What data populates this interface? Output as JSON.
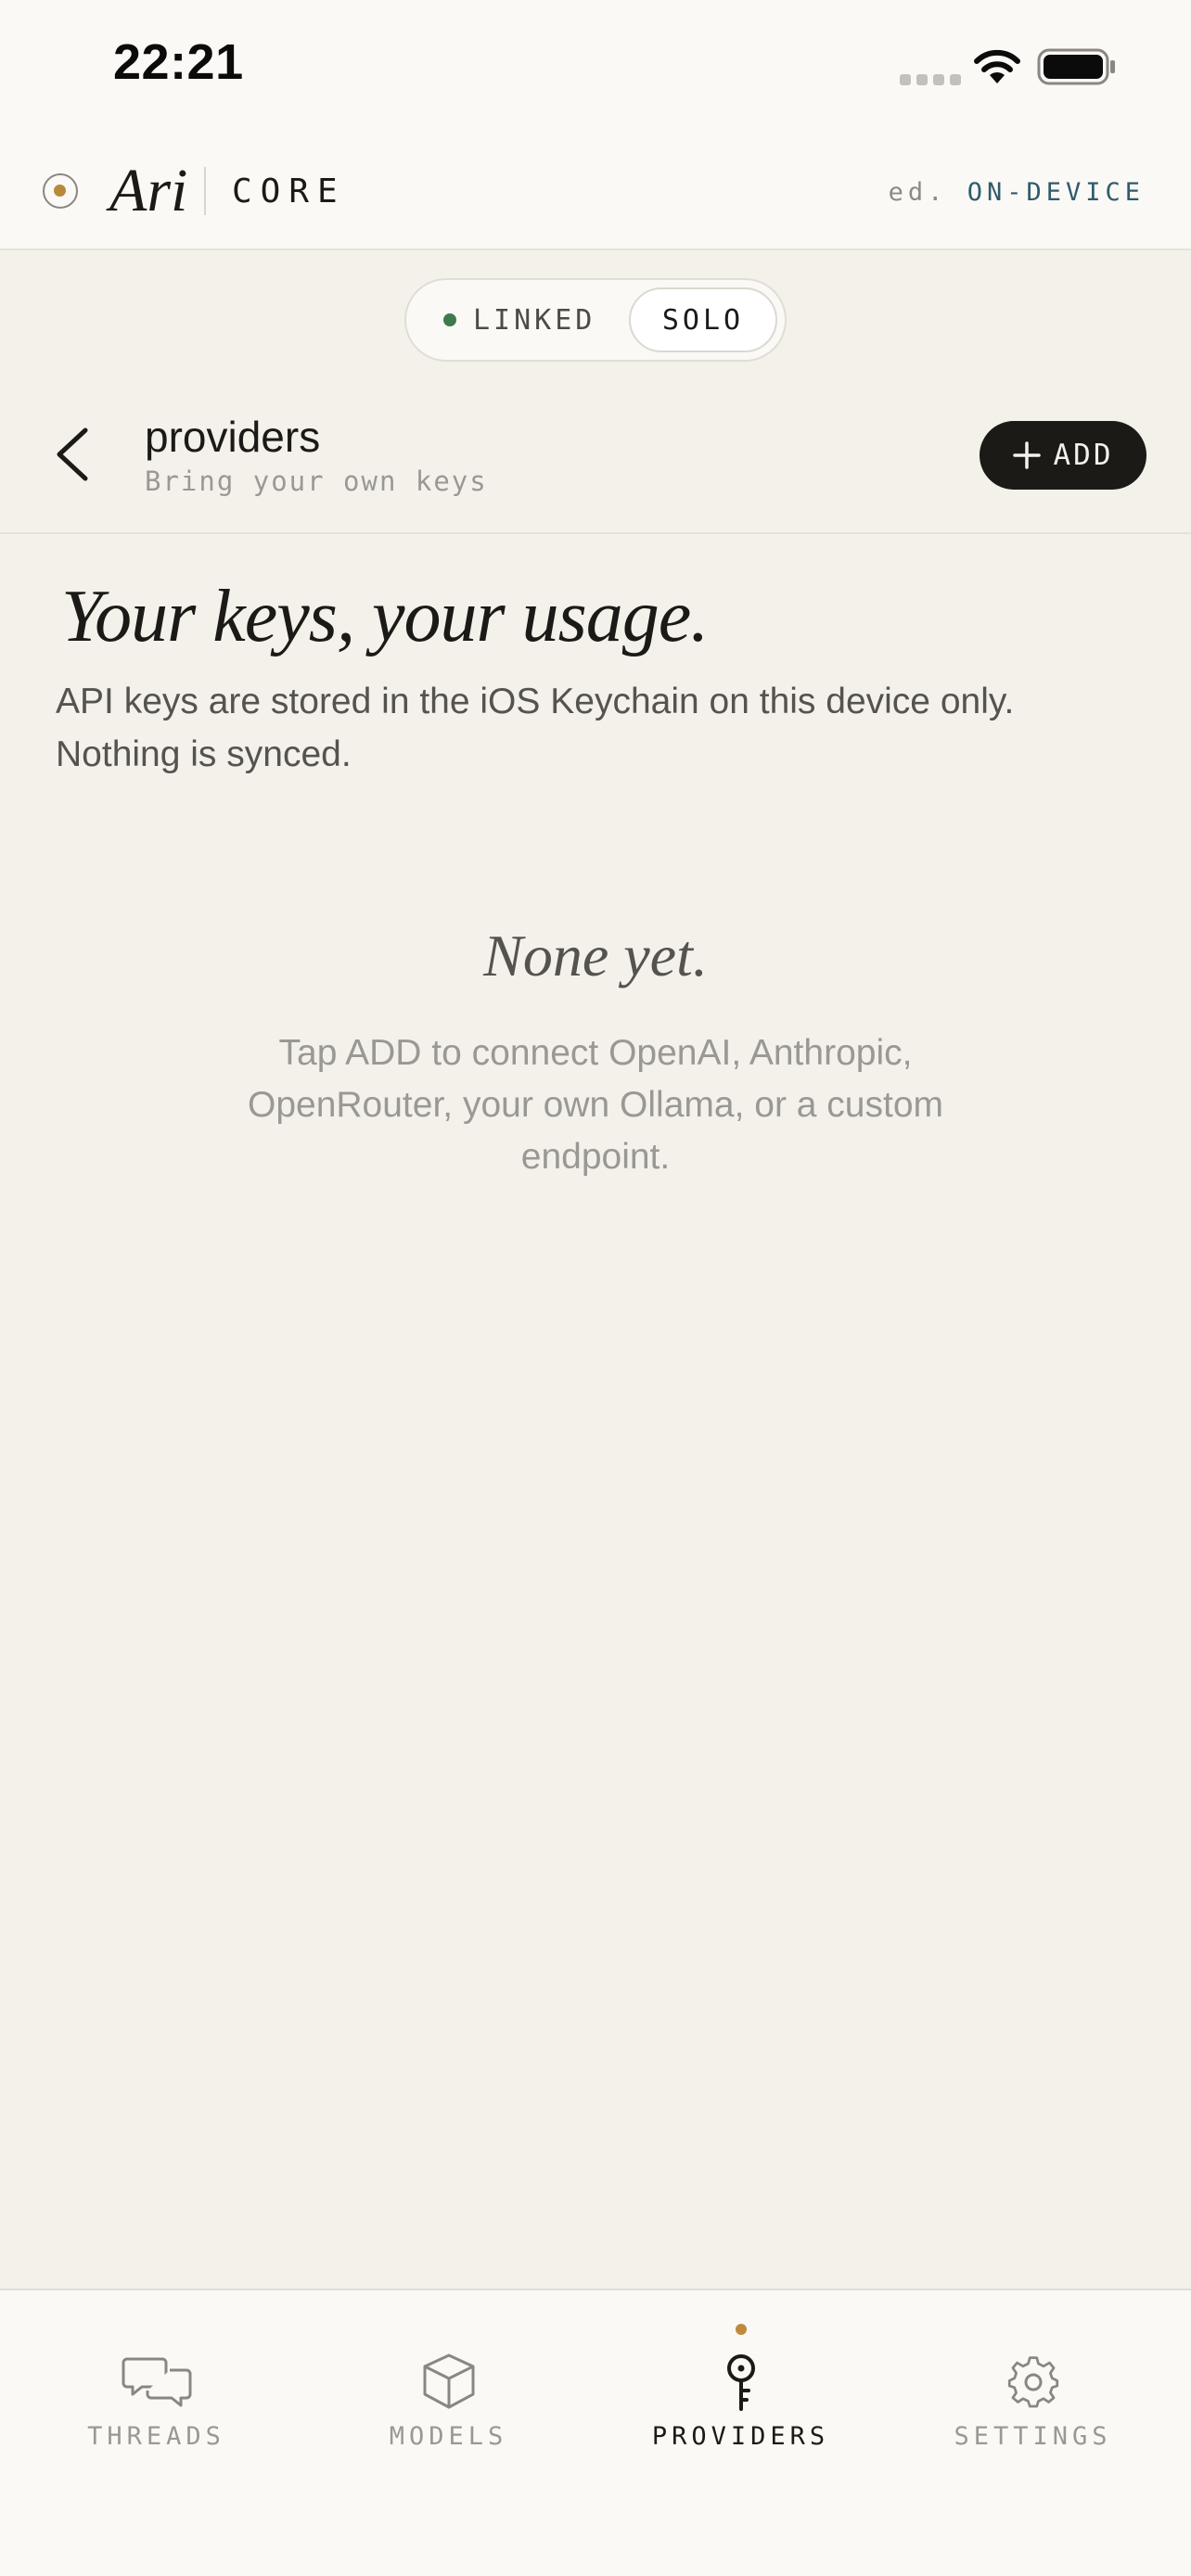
{
  "status_bar": {
    "time": "22:21"
  },
  "header": {
    "brand_name": "Ari",
    "brand_sub": "CORE",
    "edition_prefix": "ed.",
    "edition_value": "ON-DEVICE"
  },
  "mode_toggle": {
    "linked_label": "LINKED",
    "solo_label": "SOLO",
    "selected": "SOLO"
  },
  "page": {
    "title": "providers",
    "subtitle": "Bring your own keys",
    "add_label": "ADD"
  },
  "hero": {
    "title": "Your keys, your usage.",
    "body": "API keys are stored in the iOS Keychain on this device only. Nothing is synced."
  },
  "empty_state": {
    "title": "None yet.",
    "body": "Tap ADD to connect OpenAI, Anthropic, OpenRouter, your own Ollama, or a custom endpoint."
  },
  "tabs": [
    {
      "label": "THREADS",
      "icon": "chat-bubbles-icon",
      "active": false
    },
    {
      "label": "MODELS",
      "icon": "cube-icon",
      "active": false
    },
    {
      "label": "PROVIDERS",
      "icon": "key-icon",
      "active": true
    },
    {
      "label": "SETTINGS",
      "icon": "gear-icon",
      "active": false
    }
  ],
  "colors": {
    "background": "#f4f1eb",
    "surface": "#faf9f5",
    "ink": "#1b1a17",
    "accent_gold": "#b8893a",
    "linked_green": "#3d7a4e",
    "edition_teal": "#2f5b6b"
  }
}
